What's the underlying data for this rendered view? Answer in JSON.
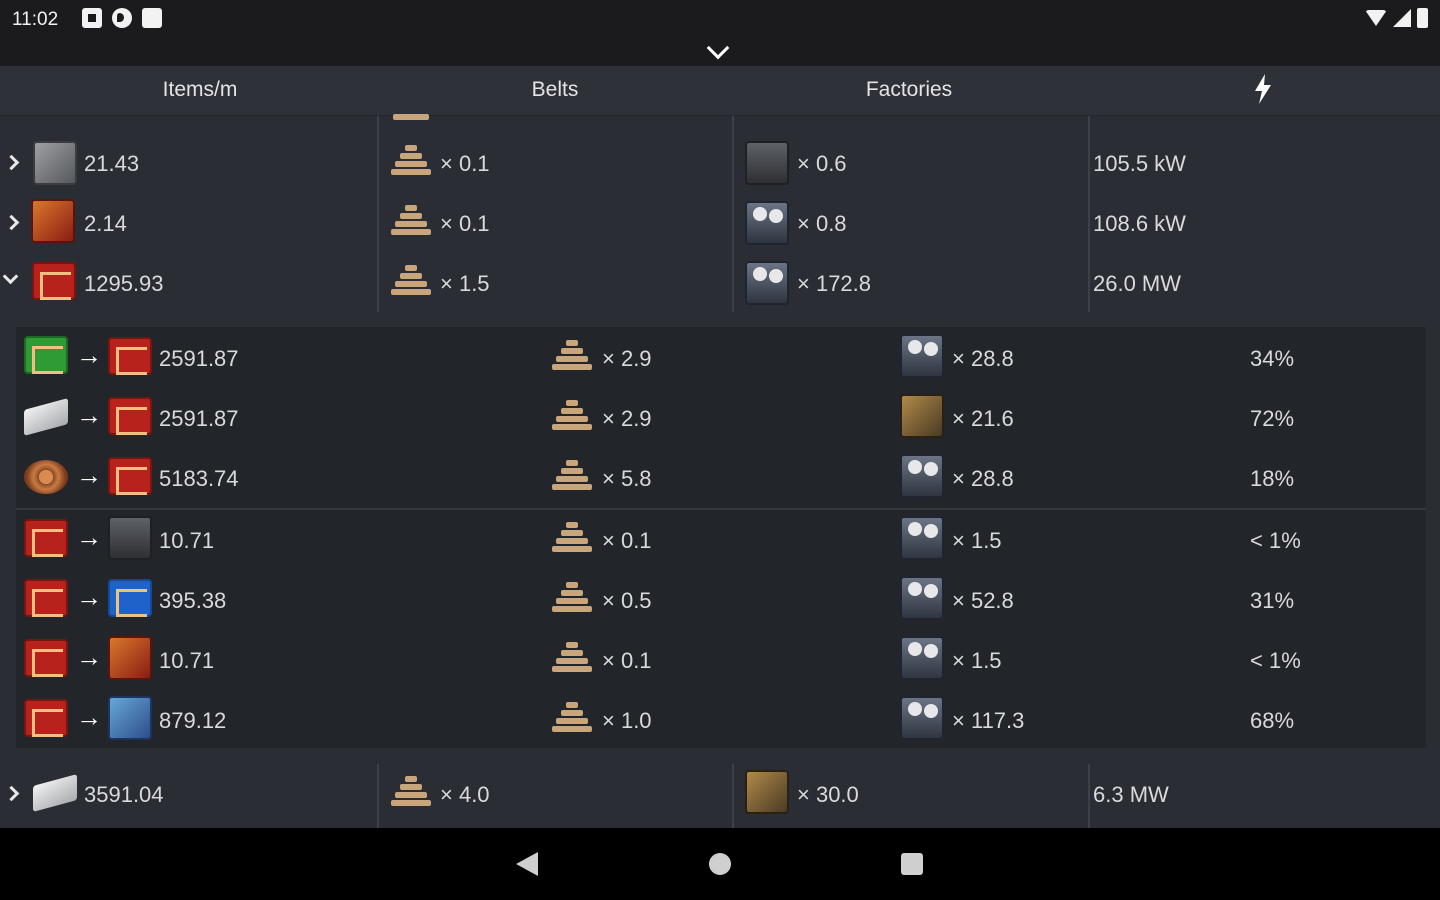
{
  "status_bar": {
    "time": "11:02"
  },
  "header": {
    "col_items": "Items/m",
    "col_belts": "Belts",
    "col_factories": "Factories",
    "col_power_icon": "lightning-bolt-icon"
  },
  "rows": [
    {
      "items": "21.43",
      "belts": "× 0.1",
      "factories": "× 0.6",
      "power": "105.5 kW"
    },
    {
      "items": "2.14",
      "belts": "× 0.1",
      "factories": "× 0.8",
      "power": "108.6 kW"
    },
    {
      "items": "1295.93",
      "belts": "× 1.5",
      "factories": "× 172.8",
      "power": "26.0 MW"
    }
  ],
  "inputs": [
    {
      "amount": "2591.87",
      "belts": "× 2.9",
      "factories": "× 28.8",
      "pct": "34%"
    },
    {
      "amount": "2591.87",
      "belts": "× 2.9",
      "factories": "× 21.6",
      "pct": "72%"
    },
    {
      "amount": "5183.74",
      "belts": "× 5.8",
      "factories": "× 28.8",
      "pct": "18%"
    }
  ],
  "outputs": [
    {
      "amount": "10.71",
      "belts": "× 0.1",
      "factories": "× 1.5",
      "pct": "< 1%"
    },
    {
      "amount": "395.38",
      "belts": "× 0.5",
      "factories": "× 52.8",
      "pct": "31%"
    },
    {
      "amount": "10.71",
      "belts": "× 0.1",
      "factories": "× 1.5",
      "pct": "< 1%"
    },
    {
      "amount": "879.12",
      "belts": "× 1.0",
      "factories": "× 117.3",
      "pct": "68%"
    }
  ],
  "bottom_row": {
    "items": "3591.04",
    "belts": "× 4.0",
    "factories": "× 30.0",
    "power": "6.3 MW"
  },
  "colors": {
    "background": "#2a2d33",
    "panel": "#22252a",
    "header": "#2e3137",
    "text": "#d9dadc"
  }
}
